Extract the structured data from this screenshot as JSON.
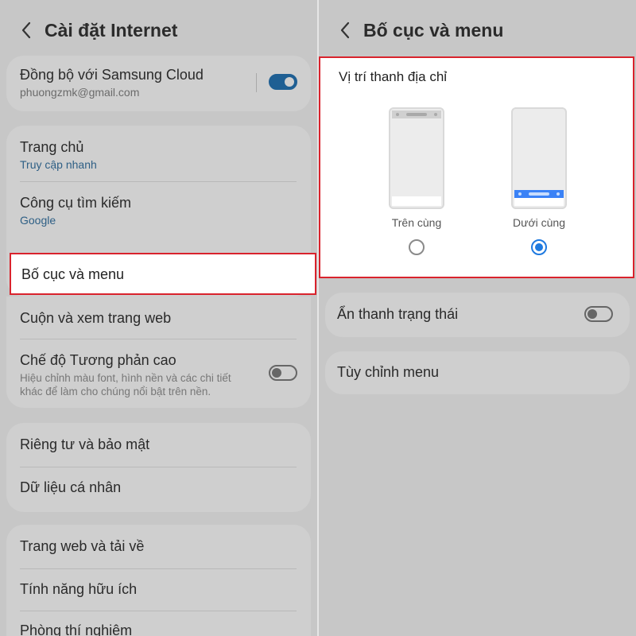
{
  "left": {
    "title": "Cài đặt Internet",
    "sync": {
      "label": "Đồng bộ với Samsung Cloud",
      "account": "phuongzmk@gmail.com",
      "enabled": true
    },
    "homepage": {
      "label": "Trang chủ",
      "value": "Truy cập nhanh"
    },
    "search_engine": {
      "label": "Công cụ tìm kiếm",
      "value": "Google"
    },
    "layout_menu": "Bố cục và menu",
    "scroll_view": "Cuộn và xem trang web",
    "high_contrast": {
      "label": "Chế độ Tương phản cao",
      "desc_line1": "Hiệu chỉnh màu font, hình nền và các chi tiết",
      "desc_line2": "khác để làm cho chúng nổi bật trên nền.",
      "enabled": false
    },
    "privacy": "Riêng tư và bảo mật",
    "personal_data": "Dữ liệu cá nhân",
    "sites_downloads": "Trang web và tải về",
    "useful_features": "Tính năng hữu ích",
    "labs": "Phòng thí nghiệm"
  },
  "right": {
    "title": "Bố cục và menu",
    "address_bar": {
      "title": "Vị trí thanh địa chỉ",
      "options": [
        {
          "label": "Trên cùng",
          "selected": false
        },
        {
          "label": "Dưới cùng",
          "selected": true
        }
      ]
    },
    "hide_status_bar": {
      "label": "Ẩn thanh trạng thái",
      "enabled": false
    },
    "customize_menu": "Tùy chỉnh menu"
  },
  "colors": {
    "accent": "#1f7ae0",
    "toggle_on": "#1f5f93",
    "highlight": "#d9232d",
    "overlay": "#c7c7c7"
  },
  "icons": {
    "back": "chevron-left-icon",
    "radio": "radio-icon",
    "toggle": "switch-icon"
  }
}
